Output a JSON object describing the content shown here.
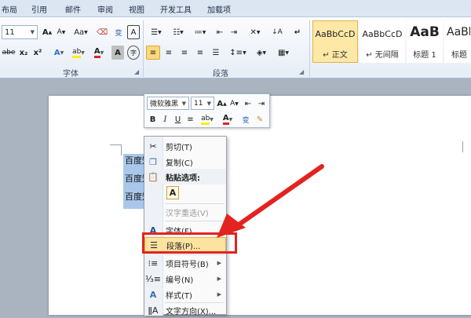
{
  "tabs": [
    "布局",
    "引用",
    "邮件",
    "审阅",
    "视图",
    "开发工具",
    "加载项"
  ],
  "font_group": {
    "label": "字体",
    "size": "11",
    "grow": "A",
    "shrink": "A",
    "case": "Aa",
    "clear": "A",
    "phonetic": "变",
    "border_char": "A",
    "strike": "abe",
    "subscript": "x₂",
    "superscript": "x²",
    "effects": "A",
    "highlight": "ab",
    "color": "A",
    "shading": "A",
    "enclose": "字"
  },
  "paragraph_group": {
    "label": "段落"
  },
  "styles": [
    {
      "sample": "AaBbCcD",
      "name": "↵ 正文"
    },
    {
      "sample": "AaBbCcD",
      "name": "↵ 无间隔"
    },
    {
      "sample": "AaB",
      "name": "标题 1"
    },
    {
      "sample": "AaBb",
      "name": "标题"
    }
  ],
  "document": {
    "lines": [
      "百度知道",
      "百度知道",
      "百度知道"
    ]
  },
  "mini_toolbar": {
    "font": "微软雅黑",
    "size": "11",
    "grow": "A",
    "shrink": "A",
    "bold": "B",
    "italic": "I",
    "underline": "U",
    "highlight": "ab",
    "color": "A",
    "phonetic": "变"
  },
  "context_menu": {
    "cut": "剪切(T)",
    "copy": "复制(C)",
    "paste_options": "粘贴选项:",
    "paste_icon": "A",
    "reconvert": "汉字重选(V)",
    "font": "字体(F)...",
    "paragraph": "段落(P)...",
    "bullets": "项目符号(B)",
    "numbering": "编号(N)",
    "styles": "样式(T)",
    "text_direction": "文字方向(X)..."
  },
  "colors": {
    "annotation": "#e3231f",
    "selection": "#a9c7ea",
    "ribbon_tab": "#dce6f2"
  }
}
